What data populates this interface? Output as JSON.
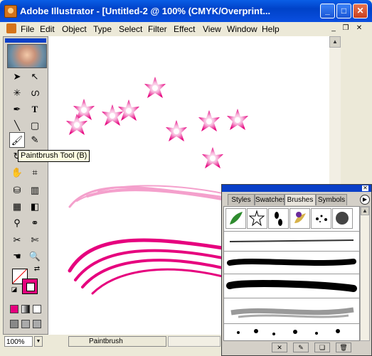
{
  "window": {
    "title": "Adobe Illustrator - [Untitled-2 @ 100% (CMYK/Overprint..."
  },
  "menubar": {
    "items": [
      "File",
      "Edit",
      "Object",
      "Type",
      "Select",
      "Filter",
      "Effect",
      "View",
      "Window",
      "Help"
    ]
  },
  "tooltip": {
    "text": "Paintbrush Tool (B)"
  },
  "status": {
    "zoom": "100%",
    "current_tool": "Paintbrush"
  },
  "brushes_panel": {
    "tabs": [
      "Styles",
      "Swatches",
      "Brushes",
      "Symbols"
    ],
    "active_tab": "Brushes",
    "calligraphic_brushes": [
      "leaf-brush",
      "star-scatter-brush",
      "footprint-brush",
      "fleur-brush",
      "ink-splatter-brush",
      "dry-ink-brush"
    ],
    "art_brushes": [
      "thin-pencil",
      "charcoal",
      "thick-ink",
      "chalk-scribble",
      "splash"
    ]
  },
  "colors": {
    "accent_pink": "#e6007e",
    "light_pink": "#f4a0cc",
    "title_blue": "#0a4fe0"
  }
}
